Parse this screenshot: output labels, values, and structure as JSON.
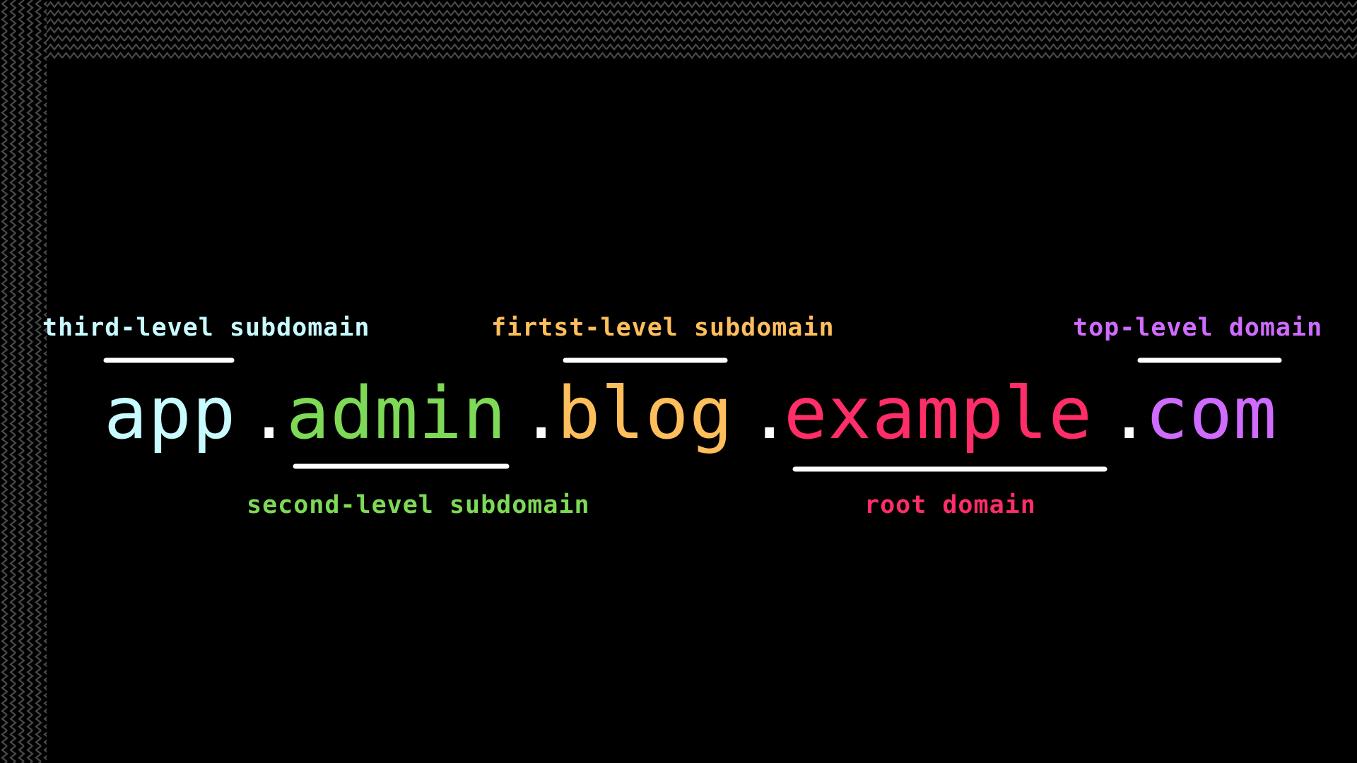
{
  "colors": {
    "background": "#000000",
    "pattern": "#4a4a4a",
    "third_level": "#c8fbff",
    "second_level": "#7ed957",
    "first_level": "#ffbe5c",
    "root": "#ff2d68",
    "top_level": "#cf6cff",
    "dot": "#ffffff",
    "underline": "#ffffff"
  },
  "domain": {
    "parts": {
      "third_level": "app",
      "dot_1": ".",
      "second_level": "admin",
      "dot_2": ".",
      "first_level": "blog",
      "dot_3": ".",
      "root": "example",
      "dot_4": ".",
      "top_level": "com"
    }
  },
  "labels": {
    "third_level": "third-level subdomain",
    "first_level": "firtst-level subdomain",
    "top_level": "top-level domain",
    "second_level": "second-level subdomain",
    "root": "root domain"
  },
  "icons": {
    "pattern": "zigzag-pattern-icon"
  }
}
